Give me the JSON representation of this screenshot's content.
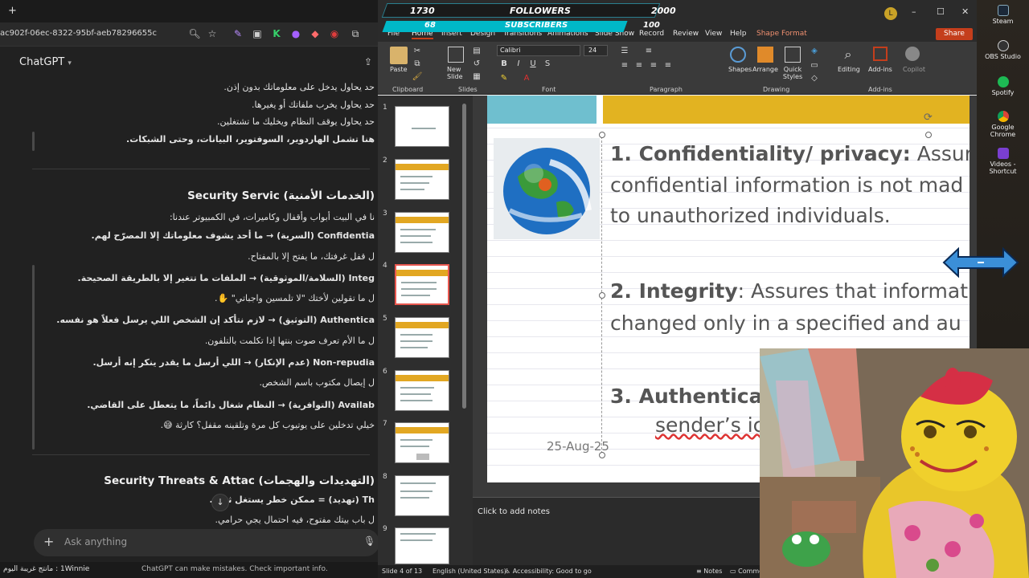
{
  "chat": {
    "url": "ac902f-06ec-8322-95bf-aeb78296655c",
    "title": "ChatGPT",
    "lines_top": [
      "حد يحاول يدخل على معلوماتك بدون إذن.",
      "حد يحاول يخرب ملفاتك أو يغيرها.",
      "حد يحاول يوقف النظام ويخليك ما تشتغلين.",
      "هنا تشمل الهاردوير، السوفتوير، البيانات، وحتى الشبكات."
    ],
    "section1_title": "Security Servic (الخدمات الأمنية)",
    "section1_lines": [
      "نا في البيت أبواب وأقفال وكاميرات، في الكمبيوتر عندنا:",
      "Confidentia (السرية) → ما أحد يشوف معلوماتك إلا المصرّح لهم.",
      "ل قفل غرفتك، ما يفتح إلا بالمفتاح.",
      "Integ (السلامة/الموثوقية) → الملفات ما تتغير إلا بالطريقة الصحيحة.",
      "ل ما تقولين لأختك \"لا تلمسين واجباتي\" ✋.",
      "Authentica (التوثيق) → لازم نتأكد إن الشخص اللي يرسل فعلاً هو نفسه.",
      "ل ما الأم تعرف صوت بنتها إذا تكلمت بالتلفون.",
      "Non-repudia (عدم الإنكار) → اللي أرسل ما يقدر ينكر إنه أرسل.",
      "ل إيصال مكتوب باسم الشخص.",
      "Availab (التوافرية) → النظام شغال دائماً، ما يتعطل على القاضي.",
      "خيلي تدخلين على يوتيوب كل مرة وتلقينه مقفل؟ كارثة 😅."
    ],
    "section2_title": "Security Threats & Attac (التهديدات والهجمات)",
    "section2_lines": [
      "Th (تهديد) = ممكن خطر يستغل ثغرة.",
      "ل باب بيتك مفتوح، فيه احتمال يجي حرامي."
    ],
    "input_placeholder": "Ask anything",
    "disclaimer": "ChatGPT can make mistakes. Check important info.",
    "ticker": "1Winnie : مانتج غريبة اليوم"
  },
  "overlay": {
    "followers_count": "1730",
    "followers_label": "FOLLOWERS",
    "followers_goal": "2000",
    "subs_count": "68",
    "subs_label": "SUBSCRIBERS",
    "subs_goal": "100"
  },
  "ppt": {
    "user_initial": "L",
    "menu": [
      "File",
      "Home",
      "Insert",
      "Design",
      "Transitions",
      "Animations",
      "Slide Show",
      "Record",
      "Review",
      "View",
      "Help",
      "Shape Format"
    ],
    "share_label": "Share",
    "font_name": "Calibri",
    "font_size": "24",
    "ribbon_buttons": {
      "paste": "Paste",
      "new_slide": "New Slide",
      "shapes": "Shapes",
      "arrange": "Arrange",
      "quick_styles": "Quick Styles",
      "editing": "Editing",
      "addins": "Add-ins",
      "copilot": "Copilot"
    },
    "groups": [
      "Clipboard",
      "Slides",
      "Font",
      "Paragraph",
      "Drawing",
      "Add-ins"
    ],
    "thumb_numbers": [
      "1",
      "2",
      "3",
      "4",
      "5",
      "6",
      "7",
      "8",
      "9"
    ],
    "slide": {
      "p1_bold": "1. Confidentiality/ privacy:",
      "p1_rest": " Assure",
      "p1_l2": "confidential information is not mad",
      "p1_l3": "to unauthorized individuals.",
      "p2_num": "2. ",
      "p2_bold": "Integrity",
      "p2_rest": ": Assures that informati",
      "p2_l2": "changed only in a specified and au",
      "p3_bold": "3. Authentica",
      "p3_l2": "sender’s ic",
      "date": "25-Aug-25"
    },
    "notes_placeholder": "Click to add notes",
    "status": {
      "slide_of": "Slide 4 of 13",
      "language": "English (United States)",
      "accessibility": "Accessibility: Good to go",
      "notes": "Notes",
      "comments": "Comme"
    }
  },
  "desktop": {
    "icons": [
      "Steam",
      "OBS Studio",
      "Spotify",
      "Google Chrome",
      "Videos - Shortcut"
    ]
  }
}
